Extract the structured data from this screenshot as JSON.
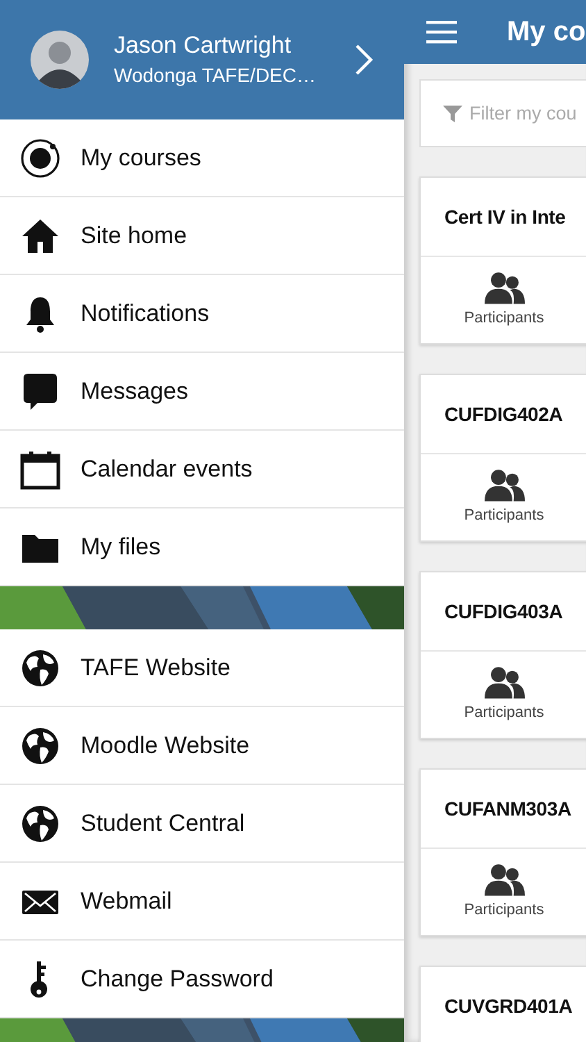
{
  "user": {
    "name": "Jason Cartwright",
    "site": "Wodonga TAFE/DEC…"
  },
  "menu": [
    {
      "label": "My courses"
    },
    {
      "label": "Site home"
    },
    {
      "label": "Notifications"
    },
    {
      "label": "Messages"
    },
    {
      "label": "Calendar events"
    },
    {
      "label": "My files"
    }
  ],
  "links": [
    {
      "label": "TAFE Website"
    },
    {
      "label": "Moodle Website"
    },
    {
      "label": "Student Central"
    },
    {
      "label": "Webmail"
    },
    {
      "label": "Change Password"
    }
  ],
  "main": {
    "title": "My co",
    "filter": {
      "placeholder": "Filter my cou"
    },
    "courses": [
      {
        "name": "Cert IV in Inte",
        "action": "Participants"
      },
      {
        "name": "CUFDIG402A",
        "action": "Participants"
      },
      {
        "name": "CUFDIG403A",
        "action": "Participants"
      },
      {
        "name": "CUFANM303A",
        "action": "Participants"
      },
      {
        "name": "CUVGRD401A"
      }
    ]
  }
}
